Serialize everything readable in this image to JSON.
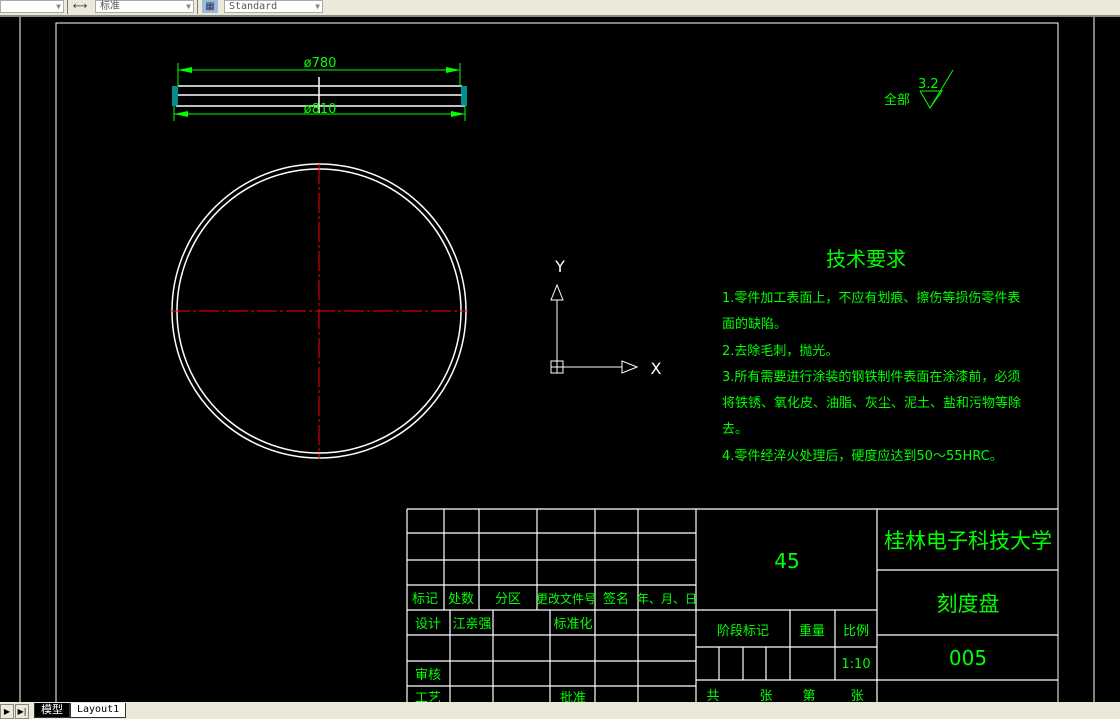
{
  "toolbar": {
    "dimstyle_value": "标准",
    "tablestyle_value": "Standard",
    "dimstyle_icon": "dimension-style-icon",
    "tablestyle_icon": "table-style-icon"
  },
  "drawing": {
    "dim_outer": "ø780",
    "dim_inner": "ø810",
    "roughness_prefix": "全部",
    "roughness_value": "3.2",
    "ucs_y": "Y",
    "ucs_x": "X",
    "colors": {
      "text": "#00ff00",
      "lines": "#ffffff",
      "centerline": "#ff0000",
      "dims": "#00ff00"
    }
  },
  "tech_requirements": {
    "title": "技术要求",
    "lines": [
      "1.零件加工表面上，不应有划痕、擦伤等损伤零件表",
      "面的缺陷。",
      "2.去除毛刺，抛光。",
      "3.所有需要进行涂装的钢铁制件表面在涂漆前，必须",
      "将铁锈、氧化皮、油脂、灰尘、泥土、盐和污物等除",
      "去。",
      "4.零件经淬火处理后，硬度应达到50～55HRC。"
    ]
  },
  "title_block": {
    "headers": [
      "标记",
      "处数",
      "分区",
      "更改文件号",
      "签名",
      "年、月、日"
    ],
    "design_label": "设计",
    "designer": "江亲强",
    "standardization": "标准化",
    "review": "审核",
    "process": "工艺",
    "approve": "批准",
    "material": "45",
    "stage_mark": "阶段标记",
    "weight": "重量",
    "scale_label": "比例",
    "scale_value": "1:10",
    "sheets_total": "共",
    "sheets_unit": "张",
    "sheet_no": "第",
    "sheet_unit2": "张",
    "school": "桂林电子科技大学",
    "part_name": "刻度盘",
    "drawing_no": "005"
  },
  "tabs": {
    "model": "模型",
    "layout1": "Layout1"
  }
}
